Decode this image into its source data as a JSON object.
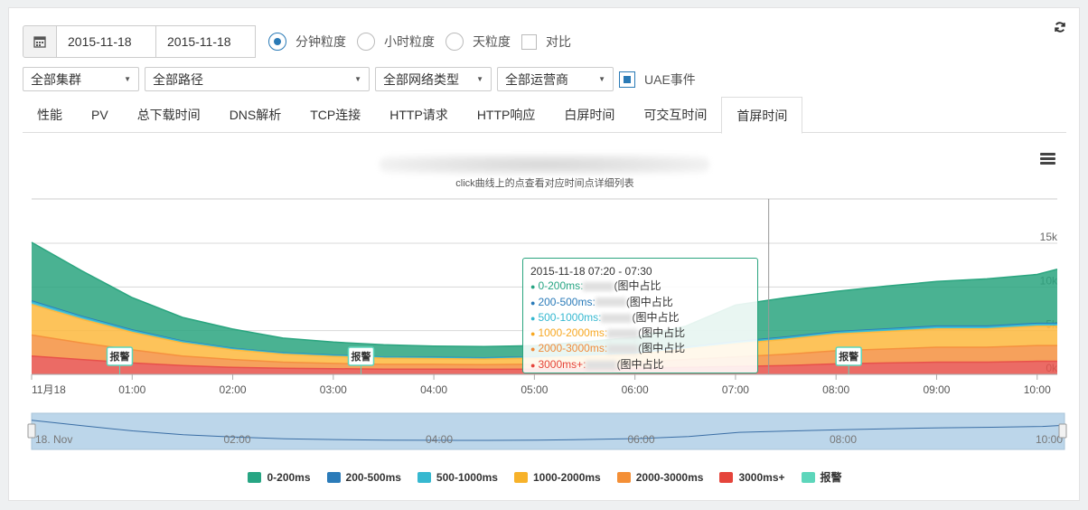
{
  "toolbar": {
    "date_start": "2015-11-18",
    "date_end": "2015-11-18",
    "granularity": [
      {
        "label": "分钟粒度",
        "selected": true
      },
      {
        "label": "小时粒度",
        "selected": false
      },
      {
        "label": "天粒度",
        "selected": false
      }
    ],
    "compare_label": "对比",
    "refresh_icon": "refresh-icon",
    "calendar_icon": "calendar-icon"
  },
  "filters": {
    "cluster": "全部集群",
    "path": "全部路径",
    "network": "全部网络类型",
    "carrier": "全部运营商",
    "uae_label": "UAE事件",
    "uae_checked": true
  },
  "tabs": [
    {
      "label": "性能",
      "active": false
    },
    {
      "label": "PV",
      "active": false
    },
    {
      "label": "总下载时间",
      "active": false
    },
    {
      "label": "DNS解析",
      "active": false
    },
    {
      "label": "TCP连接",
      "active": false
    },
    {
      "label": "HTTP请求",
      "active": false
    },
    {
      "label": "HTTP响应",
      "active": false
    },
    {
      "label": "白屏时间",
      "active": false
    },
    {
      "label": "可交互时间",
      "active": false
    },
    {
      "label": "首屏时间",
      "active": true
    }
  ],
  "chart": {
    "subtitle": "click曲线上的点查看对应时间点详细列表",
    "menu_icon": "hamburger-menu-icon",
    "alarm_label": "报警",
    "navigator_labels": [
      "18. Nov",
      "02:00",
      "04:00",
      "06:00",
      "08:00",
      "10:00"
    ],
    "tooltip": {
      "title": "2015-11-18 07:20 - 07:30",
      "rows": [
        {
          "label": "0-200ms:",
          "suffix": "(图中占比",
          "color": "#27a583"
        },
        {
          "label": "200-500ms:",
          "suffix": "(图中占比",
          "color": "#2b7bb9"
        },
        {
          "label": "500-1000ms:",
          "suffix": "(图中占比",
          "color": "#36b8d0"
        },
        {
          "label": "1000-2000ms:",
          "suffix": "(图中占比",
          "color": "#f7a823"
        },
        {
          "label": "2000-3000ms:",
          "suffix": "(图中占比",
          "color": "#f08a3a"
        },
        {
          "label": "3000ms+:",
          "suffix": "(图中占比",
          "color": "#e5443b"
        }
      ]
    }
  },
  "chart_data": {
    "type": "area",
    "stacked": true,
    "x_ticks": [
      "11月18",
      "01:00",
      "02:00",
      "03:00",
      "04:00",
      "05:00",
      "06:00",
      "07:00",
      "08:00",
      "09:00",
      "10:00"
    ],
    "y_ticks": [
      "0k",
      "5k",
      "10k",
      "15k"
    ],
    "ylim": [
      0,
      15000
    ],
    "x_hours": [
      0,
      0.5,
      1,
      1.5,
      2,
      2.5,
      3,
      3.5,
      4,
      4.5,
      5,
      5.5,
      6,
      6.5,
      7,
      7.5,
      8,
      8.5,
      9,
      9.5,
      10,
      10.2
    ],
    "series": [
      {
        "name": "3000ms+",
        "color": "#e8514a",
        "values": [
          2100,
          1700,
          1300,
          1000,
          800,
          700,
          650,
          600,
          600,
          580,
          600,
          650,
          700,
          800,
          900,
          1000,
          1200,
          1300,
          1400,
          1400,
          1500,
          1500
        ]
      },
      {
        "name": "2000-3000ms",
        "color": "#f5913f",
        "values": [
          2400,
          1900,
          1500,
          1100,
          900,
          700,
          600,
          550,
          550,
          530,
          560,
          620,
          700,
          900,
          1100,
          1300,
          1500,
          1600,
          1700,
          1700,
          1800,
          1800
        ]
      },
      {
        "name": "1000-2000ms",
        "color": "#fdb93d",
        "values": [
          3500,
          2700,
          2000,
          1500,
          1100,
          900,
          800,
          700,
          650,
          640,
          700,
          800,
          900,
          1200,
          1500,
          1700,
          1900,
          2000,
          2100,
          2100,
          2200,
          2200
        ]
      },
      {
        "name": "500-1000ms",
        "color": "#36b8d0",
        "values": [
          300,
          250,
          200,
          160,
          130,
          110,
          100,
          90,
          90,
          90,
          90,
          100,
          110,
          130,
          160,
          180,
          200,
          210,
          220,
          220,
          230,
          230
        ]
      },
      {
        "name": "200-500ms",
        "color": "#2b7bb9",
        "values": [
          100,
          90,
          80,
          60,
          50,
          40,
          40,
          40,
          40,
          40,
          40,
          40,
          50,
          60,
          70,
          80,
          90,
          90,
          100,
          100,
          100,
          100
        ]
      },
      {
        "name": "0-200ms",
        "color": "#2aa57f",
        "values": [
          6700,
          5200,
          3700,
          2700,
          2200,
          1700,
          1500,
          1400,
          1300,
          1300,
          1300,
          1500,
          1800,
          2400,
          4200,
          4500,
          4600,
          4900,
          5100,
          5400,
          5600,
          6200
        ]
      }
    ],
    "alarm_markers_at_hours": [
      0.75,
      3.15,
      8.0
    ],
    "crosshair_at_hour": 7.33
  },
  "legend": [
    {
      "label": "0-200ms",
      "color": "#27a583"
    },
    {
      "label": "200-500ms",
      "color": "#2b7bb9"
    },
    {
      "label": "500-1000ms",
      "color": "#36b8d0"
    },
    {
      "label": "1000-2000ms",
      "color": "#f7b22a"
    },
    {
      "label": "2000-3000ms",
      "color": "#f48f36"
    },
    {
      "label": "3000ms+",
      "color": "#e5443b"
    },
    {
      "label": "报警",
      "color": "#5dd6bb"
    }
  ]
}
